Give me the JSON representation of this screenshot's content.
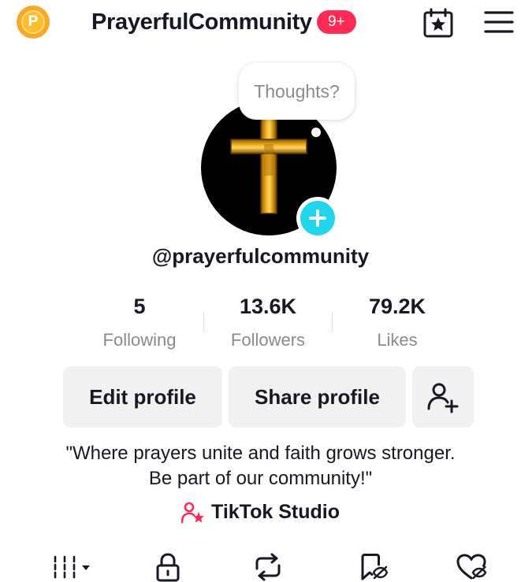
{
  "header": {
    "coin_letter": "P",
    "profile_name": "PrayerfulCommunity",
    "notification_badge": "9+"
  },
  "avatar": {
    "thought_bubble": "Thoughts?"
  },
  "username": "@prayerfulcommunity",
  "stats": [
    {
      "value": "5",
      "label": "Following"
    },
    {
      "value": "13.6K",
      "label": "Followers"
    },
    {
      "value": "79.2K",
      "label": "Likes"
    }
  ],
  "actions": {
    "edit_profile": "Edit profile",
    "share_profile": "Share profile"
  },
  "bio": {
    "line1": "\"Where prayers unite and faith grows stronger.",
    "line2": "Be part of our community!\""
  },
  "studio_link": "TikTok Studio",
  "tabs": [
    {
      "icon": "grid-icon"
    },
    {
      "icon": "lock-icon"
    },
    {
      "icon": "repost-icon"
    },
    {
      "icon": "hidden-favorites-icon"
    },
    {
      "icon": "hidden-likes-icon"
    }
  ],
  "colors": {
    "accent_red": "#fe2c55",
    "avatar_plus": "#20d5ec",
    "coin": "#f7a928",
    "muted_text": "#8a8b91",
    "button_bg": "#f1f1f2"
  }
}
